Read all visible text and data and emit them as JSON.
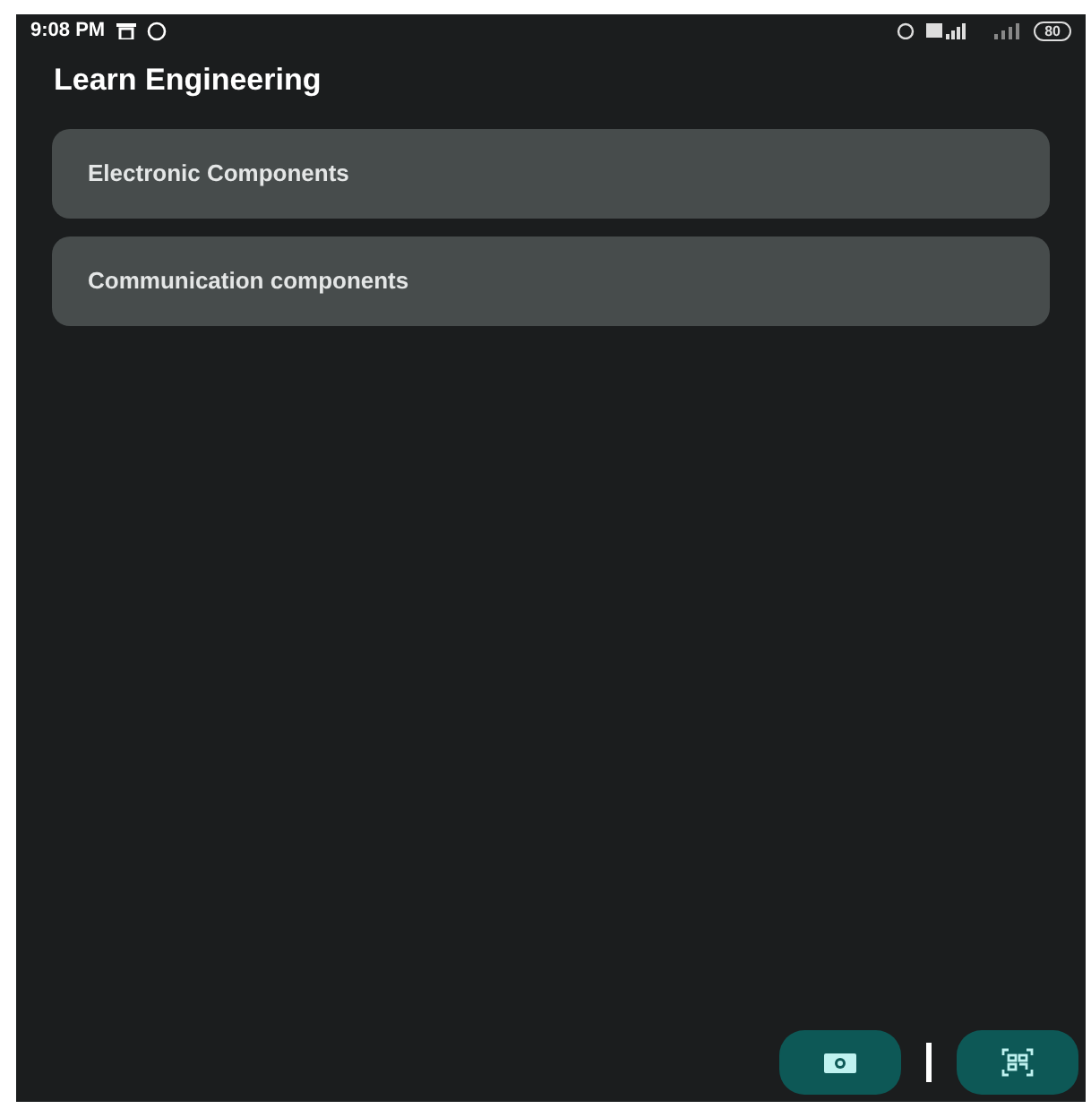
{
  "status_bar": {
    "time": "9:08 PM",
    "battery": "80"
  },
  "app_bar": {
    "title": "Learn Engineering"
  },
  "items": [
    {
      "label": "Electronic Components"
    },
    {
      "label": "Communication components"
    }
  ]
}
